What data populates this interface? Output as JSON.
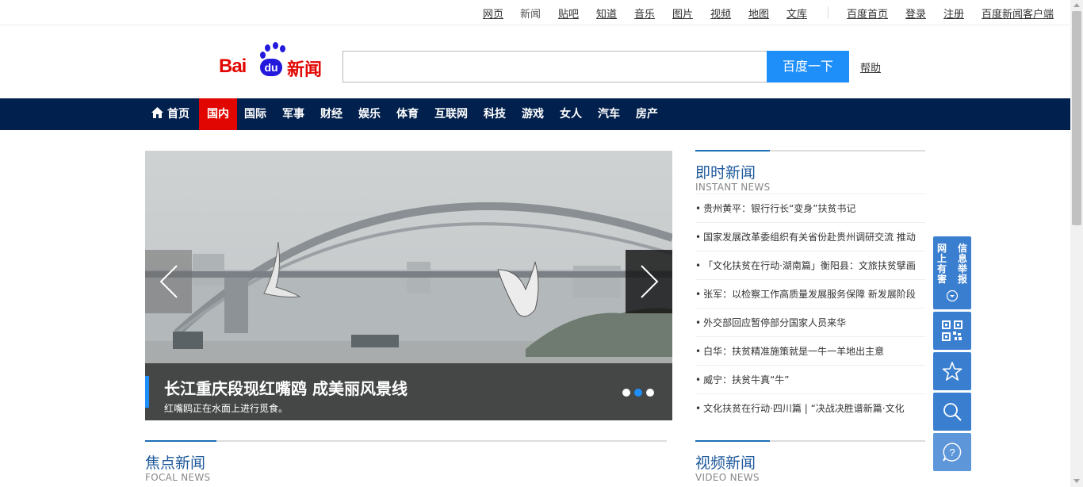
{
  "top_links": {
    "web": "网页",
    "news": "新闻",
    "tieba": "贴吧",
    "zhidao": "知道",
    "music": "音乐",
    "image": "图片",
    "video": "视频",
    "map": "地图",
    "wenku": "文库",
    "baidu_home": "百度首页",
    "login": "登录",
    "register": "注册",
    "client": "百度新闻客户端"
  },
  "logo": {
    "bai": "Bai",
    "du": "du",
    "news": "新闻"
  },
  "search": {
    "value": "",
    "button": "百度一下",
    "help": "帮助"
  },
  "nav": {
    "home": "首页",
    "domestic": "国内",
    "international": "国际",
    "military": "军事",
    "finance": "财经",
    "entertainment": "娱乐",
    "sports": "体育",
    "internet": "互联网",
    "tech": "科技",
    "games": "游戏",
    "women": "女人",
    "auto": "汽车",
    "house": "房产"
  },
  "carousel": {
    "title": "长江重庆段现红嘴鸥 成美丽风景线",
    "subtitle": "红嘴鸥正在水面上进行觅食。",
    "slide_count": 3,
    "active_slide": 2
  },
  "instant_news": {
    "title_cn": "即时新闻",
    "title_en": "INSTANT NEWS",
    "items": [
      "贵州黄平：银行行长“变身”扶贫书记",
      "国家发展改革委组织有关省份赴贵州调研交流 推动",
      "「文化扶贫在行动·湖南篇」衡阳县：文旅扶贫擘画",
      "张军：以检察工作高质量发展服务保障 新发展阶段",
      "外交部回应暂停部分国家人员来华",
      "白华：扶贫精准施策就是一牛一羊地出主意",
      "威宁：扶贫牛真“牛”",
      "文化扶贫在行动·四川篇 | “决战决胜谱新篇·文化"
    ]
  },
  "focal_news": {
    "title_cn": "焦点新闻",
    "title_en": "FOCAL NEWS"
  },
  "video_news": {
    "title_cn": "视频新闻",
    "title_en": "VIDEO NEWS"
  },
  "side_tools": {
    "report": [
      "网",
      "信",
      "上",
      "息",
      "有",
      "举",
      "害",
      "报"
    ],
    "report_text": "网上有害信息举报"
  },
  "colors": {
    "brand_red": "#e10601",
    "brand_blue": "#2319dc",
    "nav_bg": "#01204d",
    "accent_blue": "#1e8ff9",
    "tool_blue": "#3a7ed0"
  }
}
